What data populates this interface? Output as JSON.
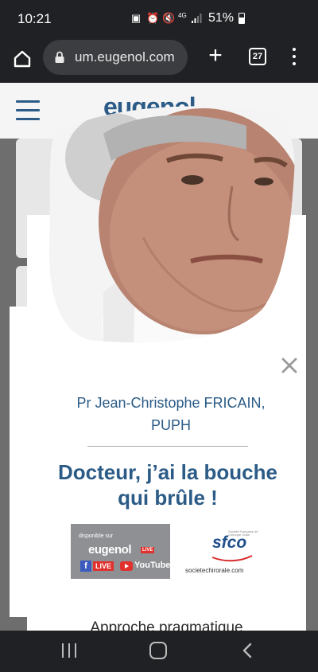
{
  "status_bar": {
    "time": "10:21",
    "network": "4G",
    "battery_percent": "51%"
  },
  "browser": {
    "url": "um.eugenol.com",
    "tab_count": "27"
  },
  "site": {
    "logo_text": "eugenol"
  },
  "modal": {
    "author_name": "Pr Jean-Christophe FRICAIN,",
    "author_title": "PUPH",
    "headline_line1": "Docteur, j’ai la bouche",
    "headline_line2": "qui brûle !",
    "partner_eugenol": {
      "available_on": "disponible sur",
      "logo": "eugenol",
      "live_badge": "LIVE",
      "facebook_live": "LIVE",
      "youtube": "YouTube"
    },
    "partner_sfco": {
      "logo": "sfco",
      "tagline": "Société Française de Chirurgie Orale",
      "url": "societechirorale.com"
    },
    "teaser": "Approche pragmatique"
  },
  "colors": {
    "brand_blue": "#2b5b86",
    "system_bar": "#202124",
    "live_red": "#e0312e"
  }
}
